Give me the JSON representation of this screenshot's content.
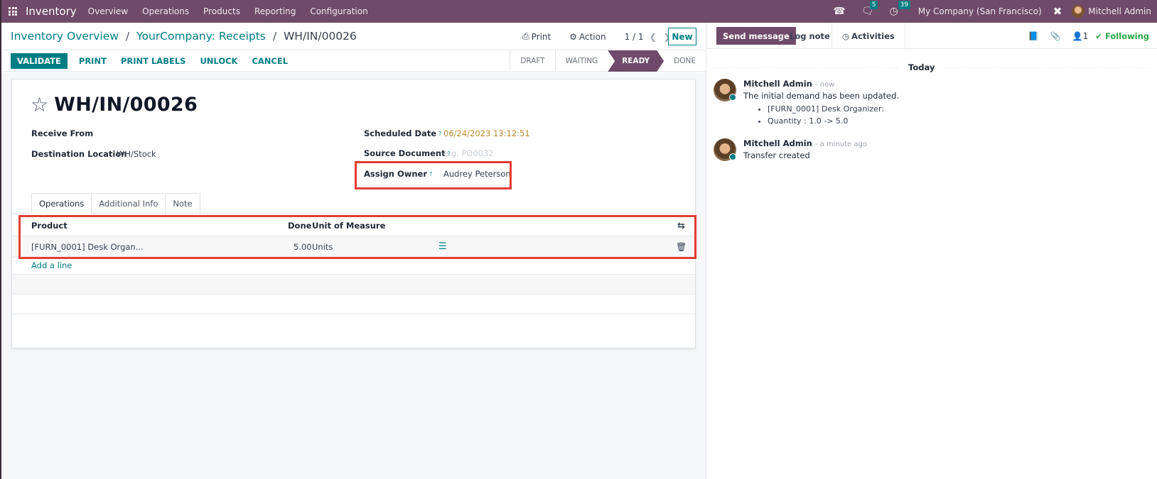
{
  "navbar": {
    "app_name": "Inventory",
    "menu": [
      "Overview",
      "Operations",
      "Products",
      "Reporting",
      "Configuration"
    ],
    "messages_count": "5",
    "activities_count": "39",
    "company": "My Company (San Francisco)",
    "user": "Mitchell Admin"
  },
  "breadcrumb": {
    "items": [
      "Inventory Overview",
      "YourCompany: Receipts"
    ],
    "separator": "/",
    "current": "WH/IN/00026"
  },
  "control": {
    "print_label": "Print",
    "action_label": "Action",
    "pager": "1 / 1",
    "new_label": "New"
  },
  "statusbar": {
    "buttons": [
      "VALIDATE",
      "PRINT",
      "PRINT LABELS",
      "UNLOCK",
      "CANCEL"
    ],
    "stages": [
      "DRAFT",
      "WAITING",
      "READY",
      "DONE"
    ],
    "active_stage": "READY"
  },
  "form": {
    "title": "WH/IN/00026",
    "receive_from": {
      "label": "Receive From",
      "value": ""
    },
    "destination": {
      "label": "Destination Location",
      "value": "WH/Stock"
    },
    "scheduled_date": {
      "label": "Scheduled Date",
      "help": "?",
      "value": "06/24/2023 13:12:51"
    },
    "source_document": {
      "label": "Source Document",
      "help": "?",
      "placeholder": "e.g. PO0032"
    },
    "assign_owner": {
      "label": "Assign Owner",
      "help": "?",
      "value": "Audrey Peterson"
    },
    "tabs": [
      "Operations",
      "Additional Info",
      "Note"
    ],
    "active_tab": "Operations",
    "table": {
      "headers": {
        "product": "Product",
        "done": "Done",
        "uom": "Unit of Measure"
      },
      "rows": [
        {
          "product": "[FURN_0001] Desk Organ...",
          "done": "5.00",
          "uom": "Units"
        }
      ],
      "add_line": "Add a line"
    }
  },
  "chatter": {
    "send_message": "Send message",
    "log_note": "Log note",
    "activities": "Activities",
    "followers_count": "1",
    "following": "Following",
    "date_separator": "Today",
    "messages": [
      {
        "author": "Mitchell Admin",
        "time": "- now",
        "body": "The initial demand has been updated.",
        "items": [
          "[FURN_0001] Desk Organizer:",
          "Quantity : 1.0 -> 5.0"
        ]
      },
      {
        "author": "Mitchell Admin",
        "time": "- a minute ago",
        "body": "Transfer created"
      }
    ]
  },
  "colors": {
    "brand": "#6f4a6a",
    "accent": "#017e84",
    "highlight_box": "#e23d34",
    "following": "#28a745",
    "date": "#b88a2d"
  }
}
